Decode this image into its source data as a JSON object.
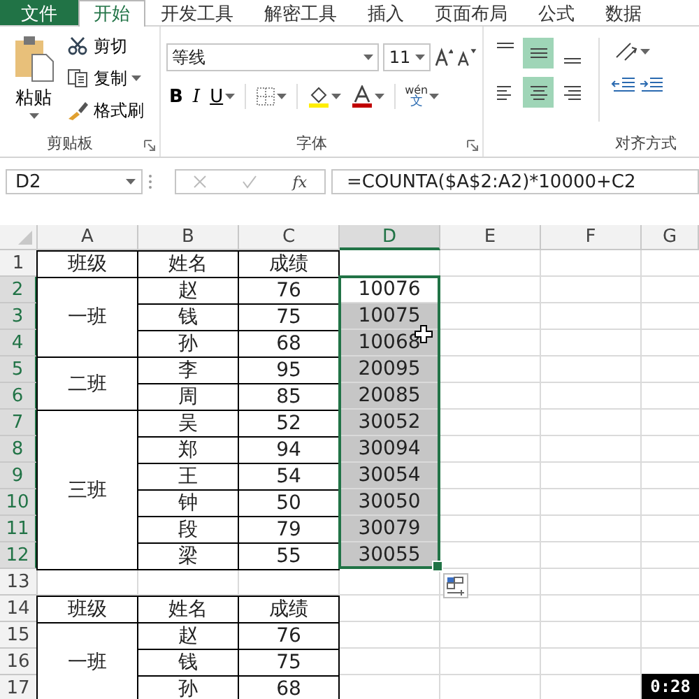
{
  "ribbon": {
    "tabs": [
      {
        "label": "文件",
        "kind": "file",
        "selected": false
      },
      {
        "label": "开始",
        "kind": "tab",
        "selected": true
      },
      {
        "label": "开发工具",
        "kind": "tab",
        "selected": false
      },
      {
        "label": "解密工具",
        "kind": "tab",
        "selected": false
      },
      {
        "label": "插入",
        "kind": "tab",
        "selected": false
      },
      {
        "label": "页面布局",
        "kind": "tab",
        "selected": false
      },
      {
        "label": "公式",
        "kind": "tab",
        "selected": false
      },
      {
        "label": "数据",
        "kind": "tab",
        "selected": false
      }
    ],
    "clipboard": {
      "label": "剪贴板",
      "paste": "粘贴",
      "commands": [
        {
          "label": "剪切",
          "kind": "cut",
          "dropdown": false
        },
        {
          "label": "复制",
          "kind": "copy",
          "dropdown": true
        },
        {
          "label": "格式刷",
          "kind": "brush",
          "dropdown": false
        }
      ]
    },
    "font": {
      "label": "字体",
      "font_name": "等线",
      "font_size": "11",
      "styles": [
        {
          "label": "B",
          "kind": "bold"
        },
        {
          "label": "I",
          "kind": "italic"
        },
        {
          "label": "U",
          "kind": "underline"
        }
      ],
      "phonetic": "wén",
      "phonetic_char": "文"
    },
    "alignment": {
      "label": "对齐方式",
      "vertical": [
        {
          "kind": "top",
          "selected": false
        },
        {
          "kind": "middle",
          "selected": true
        },
        {
          "kind": "bottom",
          "selected": false
        }
      ],
      "horizontal": [
        {
          "kind": "left",
          "selected": false
        },
        {
          "kind": "center",
          "selected": true
        },
        {
          "kind": "right",
          "selected": false
        }
      ]
    }
  },
  "formula_bar": {
    "name_box": "D2",
    "function_label": "fx",
    "formula": "=COUNTA($A$2:A2)*10000+C2"
  },
  "sheet": {
    "columns": [
      {
        "label": "A",
        "selected": false
      },
      {
        "label": "B",
        "selected": false
      },
      {
        "label": "C",
        "selected": false
      },
      {
        "label": "D",
        "selected": true
      },
      {
        "label": "E",
        "selected": false
      },
      {
        "label": "F",
        "selected": false
      },
      {
        "label": "G",
        "selected": false
      }
    ],
    "row_numbers": [
      {
        "label": "1",
        "selected": false
      },
      {
        "label": "2",
        "selected": true
      },
      {
        "label": "3",
        "selected": true
      },
      {
        "label": "4",
        "selected": true
      },
      {
        "label": "5",
        "selected": true
      },
      {
        "label": "6",
        "selected": true
      },
      {
        "label": "7",
        "selected": true
      },
      {
        "label": "8",
        "selected": true
      },
      {
        "label": "9",
        "selected": true
      },
      {
        "label": "10",
        "selected": true
      },
      {
        "label": "11",
        "selected": true
      },
      {
        "label": "12",
        "selected": true
      },
      {
        "label": "13",
        "selected": false
      },
      {
        "label": "14",
        "selected": false
      },
      {
        "label": "15",
        "selected": false
      },
      {
        "label": "16",
        "selected": false
      },
      {
        "label": "17",
        "selected": false
      }
    ],
    "tables": [
      {
        "header": [
          "班级",
          "姓名",
          "成绩"
        ],
        "groups": [
          {
            "label": "一班",
            "rows": [
              {
                "name": "赵",
                "score": "76",
                "result": {
                  "value": "10076",
                  "active": true
                }
              },
              {
                "name": "钱",
                "score": "75",
                "result": {
                  "value": "10075",
                  "active": false
                }
              },
              {
                "name": "孙",
                "score": "68",
                "result": {
                  "value": "10068",
                  "active": false
                }
              }
            ]
          },
          {
            "label": "二班",
            "rows": [
              {
                "name": "李",
                "score": "95",
                "result": {
                  "value": "20095",
                  "active": false
                }
              },
              {
                "name": "周",
                "score": "85",
                "result": {
                  "value": "20085",
                  "active": false
                }
              }
            ]
          },
          {
            "label": "三班",
            "rows": [
              {
                "name": "吴",
                "score": "52",
                "result": {
                  "value": "30052",
                  "active": false
                }
              },
              {
                "name": "郑",
                "score": "94",
                "result": {
                  "value": "30094",
                  "active": false
                }
              },
              {
                "name": "王",
                "score": "54",
                "result": {
                  "value": "30054",
                  "active": false
                }
              },
              {
                "name": "钟",
                "score": "50",
                "result": {
                  "value": "30050",
                  "active": false
                }
              },
              {
                "name": "段",
                "score": "79",
                "result": {
                  "value": "30079",
                  "active": false
                }
              },
              {
                "name": "梁",
                "score": "55",
                "result": {
                  "value": "30055",
                  "active": false
                }
              }
            ]
          }
        ]
      },
      {
        "header": [
          "班级",
          "姓名",
          "成绩"
        ],
        "groups": [
          {
            "label": "一班",
            "rows": [
              {
                "name": "赵",
                "score": "76"
              },
              {
                "name": "钱",
                "score": "75"
              },
              {
                "name": "孙",
                "score": "68"
              }
            ]
          }
        ]
      }
    ]
  },
  "video_time": "0:28"
}
